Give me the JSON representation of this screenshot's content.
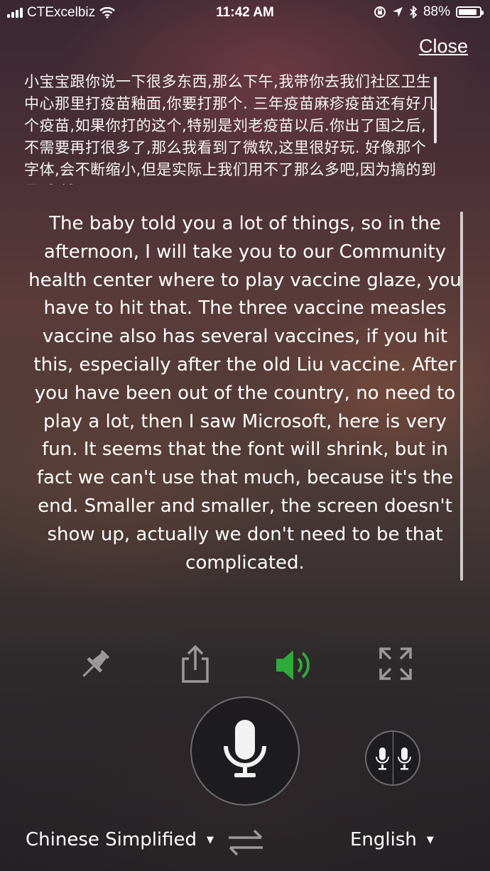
{
  "status_bar": {
    "carrier": "CTExcelbiz",
    "time": "11:42 AM",
    "battery": "88%",
    "battery_level": 0.88
  },
  "header": {
    "close_label": "Close"
  },
  "source_text": "小宝宝跟你说一下很多东西,那么下午,我带你去我们社区卫生中心那里打疫苗釉面,你要打那个. 三年疫苗麻疹疫苗还有好几个疫苗,如果你打的这个,特别是刘老疫苗以后.你出了国之后,不需要再打很多了,那么我看到了微软,这里很好玩. 好像那个字体,会不断缩小,但是实际上我们用不了那么多吧,因为搞的到最后,越",
  "translation_text": "The baby told you a lot of things, so in the afternoon, I will take you to our Community health center where to play vaccine glaze, you have to hit that. The three vaccine measles vaccine also has several vaccines, if you hit this, especially after the old Liu vaccine. After you have been out of the country, no need to play a lot, then I saw Microsoft, here is very fun. It seems that the font will shrink, but in fact we can't use that much, because it's the end. Smaller and smaller, the screen doesn't show up, actually we don't need to be that complicated.",
  "toolbar": {
    "icons": [
      "pin-icon",
      "share-icon",
      "speaker-icon",
      "fullscreen-icon"
    ],
    "speaker_color": "#2eaa3a"
  },
  "languages": {
    "source": "Chinese Simplified",
    "target": "English"
  }
}
